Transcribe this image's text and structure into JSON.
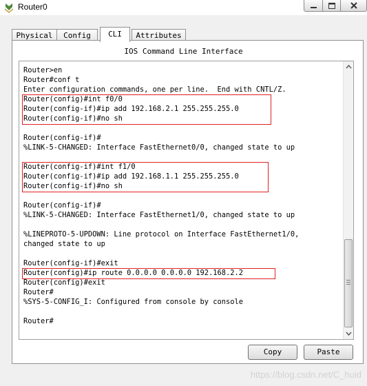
{
  "window": {
    "title": "Router0",
    "icon": "router-icon"
  },
  "tabs": [
    {
      "label": "Physical",
      "active": false
    },
    {
      "label": "Config",
      "active": false
    },
    {
      "label": "CLI",
      "active": true
    },
    {
      "label": "Attributes",
      "active": false
    }
  ],
  "panel": {
    "heading": "IOS Command Line Interface"
  },
  "console": {
    "lines": [
      "Router>en",
      "Router#conf t",
      "Enter configuration commands, one per line.  End with CNTL/Z.",
      "Router(config)#int f0/0",
      "Router(config-if)#ip add 192.168.2.1 255.255.255.0",
      "Router(config-if)#no sh",
      "",
      "Router(config-if)#",
      "%LINK-5-CHANGED: Interface FastEthernet0/0, changed state to up",
      "",
      "Router(config-if)#int f1/0",
      "Router(config-if)#ip add 192.168.1.1 255.255.255.0",
      "Router(config-if)#no sh",
      "",
      "Router(config-if)#",
      "%LINK-5-CHANGED: Interface FastEthernet1/0, changed state to up",
      "",
      "%LINEPROTO-5-UPDOWN: Line protocol on Interface FastEthernet1/0,",
      "changed state to up",
      "",
      "Router(config-if)#exit",
      "Router(config)#ip route 0.0.0.0 0.0.0.0 192.168.2.2",
      "Router(config)#exit",
      "Router#",
      "%SYS-5-CONFIG_I: Configured from console by console",
      "",
      "Router#"
    ],
    "highlight_color": "#e02020"
  },
  "buttons": {
    "copy": "Copy",
    "paste": "Paste"
  },
  "watermark": "https://blog.csdn.net/C_huid"
}
